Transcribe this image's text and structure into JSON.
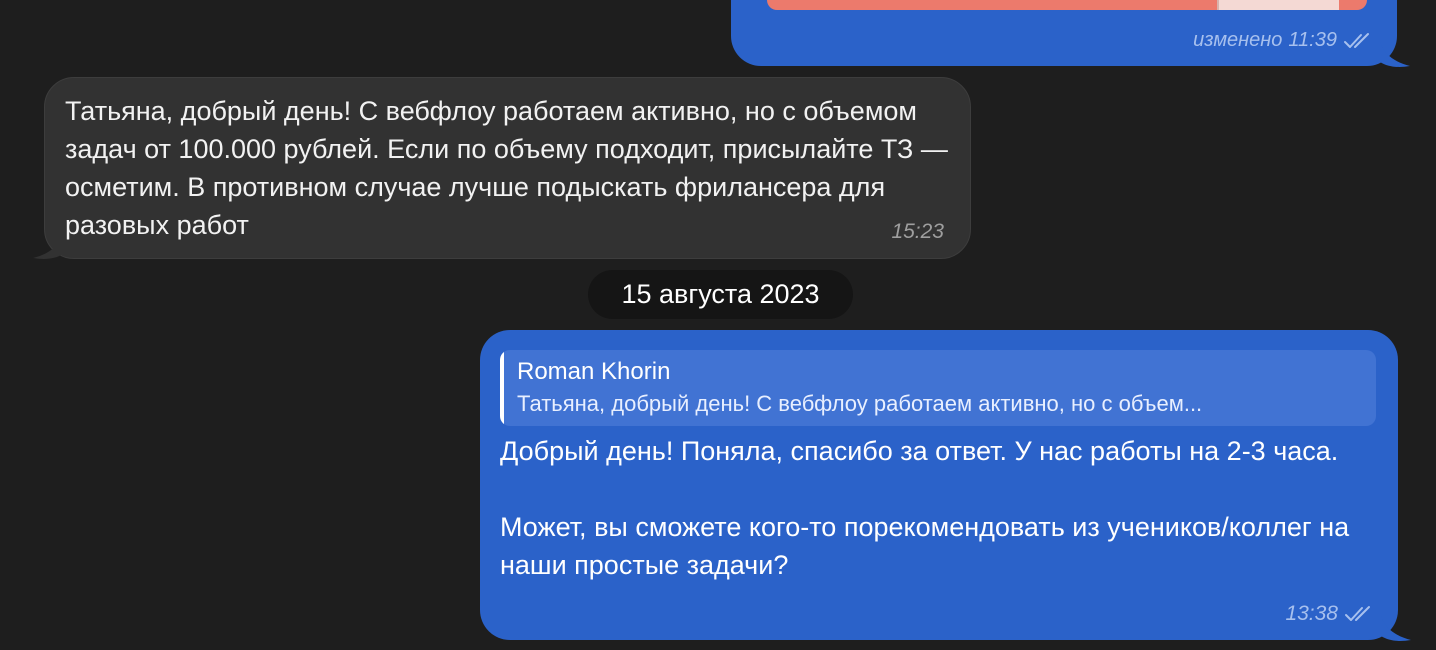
{
  "colors": {
    "background": "#1e1e1e",
    "outgoing_bubble": "#2b62c9",
    "incoming_bubble": "#323232",
    "reply_block": "#4173d3",
    "attachment": "#ec7a6c",
    "date_pill": "#151515"
  },
  "messages": {
    "top_outgoing": {
      "edited_label": "изменено",
      "time": "11:39",
      "status_icon": "double-check-icon"
    },
    "incoming": {
      "text": "Татьяна, добрый день! С вебфлоу работаем активно, но с объемом задач от 100.000 рублей. Если по объему подходит, присылайте ТЗ — осметим. В противном случае лучше подыскать фрилансера для разовых работ",
      "time": "15:23"
    },
    "date_separator": "15 августа 2023",
    "outgoing": {
      "reply": {
        "author": "Roman Khorin",
        "snippet": "Татьяна, добрый день! С вебфлоу работаем активно, но с объем..."
      },
      "paragraph_1": "Добрый день! Поняла, спасибо за ответ. У нас работы на 2-3 часа.",
      "paragraph_2": "Может, вы сможете кого-то порекомендовать из учеников/коллег на наши простые задачи?",
      "time": "13:38",
      "status_icon": "double-check-icon"
    }
  }
}
